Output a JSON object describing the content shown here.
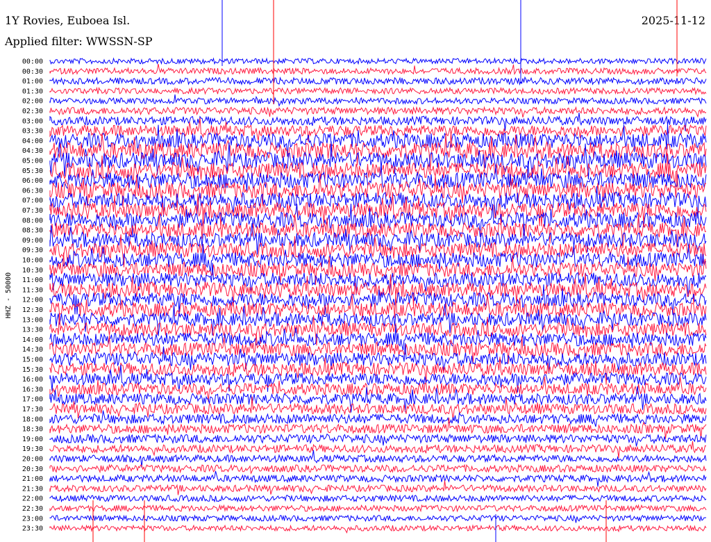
{
  "header": {
    "station": "1Y Rovies, Euboea Isl.",
    "date": "2025-11-12",
    "filter": "Applied filter: WWSSN-SP"
  },
  "channel_label": "HHZ - 50000",
  "colors": {
    "even": "#0000ff",
    "odd": "#ff1a40",
    "spike": "#ff0000",
    "spike_blue": "#0000ff"
  },
  "chart_data": {
    "type": "helicorder",
    "ylabel": "HHZ - 50000",
    "rows": [
      "00:00",
      "00:30",
      "01:00",
      "01:30",
      "02:00",
      "02:30",
      "03:00",
      "03:30",
      "04:00",
      "04:30",
      "05:00",
      "05:30",
      "06:00",
      "06:30",
      "07:00",
      "07:30",
      "08:00",
      "08:30",
      "09:00",
      "09:30",
      "10:00",
      "10:30",
      "11:00",
      "11:30",
      "12:00",
      "12:30",
      "13:00",
      "13:30",
      "14:00",
      "14:30",
      "15:00",
      "15:30",
      "16:00",
      "16:30",
      "17:00",
      "17:30",
      "18:00",
      "18:30",
      "19:00",
      "19:30",
      "20:00",
      "20:30",
      "21:00",
      "21:30",
      "22:00",
      "22:30",
      "23:00",
      "23:30"
    ],
    "row_noise_level": [
      0.15,
      0.2,
      0.25,
      0.2,
      0.2,
      0.3,
      0.4,
      0.6,
      0.9,
      1.0,
      1.0,
      1.0,
      1.0,
      1.0,
      0.95,
      0.95,
      0.95,
      0.9,
      0.9,
      0.9,
      0.9,
      0.85,
      0.85,
      0.85,
      0.85,
      0.85,
      0.8,
      0.8,
      0.8,
      0.8,
      0.8,
      0.75,
      0.7,
      0.65,
      0.6,
      0.55,
      0.5,
      0.45,
      0.4,
      0.35,
      0.3,
      0.3,
      0.28,
      0.26,
      0.22,
      0.2,
      0.18,
      0.16
    ]
  }
}
